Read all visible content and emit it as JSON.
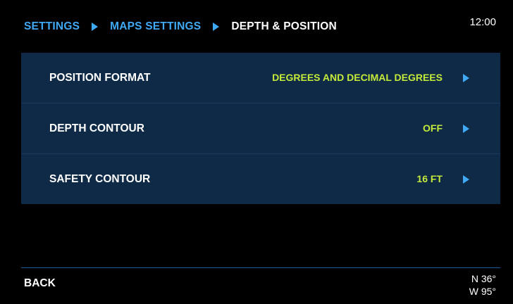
{
  "breadcrumb": {
    "items": [
      {
        "label": "SETTINGS",
        "current": false
      },
      {
        "label": "MAPS SETTINGS",
        "current": false
      },
      {
        "label": "DEPTH & POSITION",
        "current": true
      }
    ]
  },
  "clock": {
    "time": "12:00"
  },
  "settings": {
    "rows": [
      {
        "label": "POSITION FORMAT",
        "value": "DEGREES AND DECIMAL DEGREES"
      },
      {
        "label": "DEPTH CONTOUR",
        "value": "OFF"
      },
      {
        "label": "SAFETY CONTOUR",
        "value": "16 FT"
      }
    ]
  },
  "footer": {
    "back_label": "BACK",
    "latitude": "N 36°",
    "longitude": "W 95°"
  },
  "colors": {
    "background": "#000000",
    "panel": "#0f2a47",
    "accent_blue": "#3fa9f5",
    "value_green": "#c5ea3a"
  },
  "icons": {
    "breadcrumb_separator": "chevron-right-icon",
    "row_arrow": "chevron-right-icon"
  }
}
